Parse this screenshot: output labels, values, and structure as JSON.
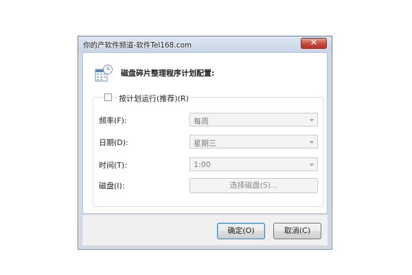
{
  "window": {
    "title": "你的产软件频道-软件Tel168.com",
    "close_symbol": "✕"
  },
  "dialog": {
    "heading": "磁盘碎片整理程序计划配置:",
    "schedule_checkbox": {
      "label": "按计划运行(推荐)(R)",
      "checked": false
    },
    "rows": {
      "frequency": {
        "label": "频率(F):",
        "value": "每周"
      },
      "day": {
        "label": "日期(D):",
        "value": "星期三"
      },
      "time": {
        "label": "时间(T):",
        "value": "1:00"
      },
      "disks": {
        "label": "磁盘(I):",
        "button_label": "选择磁盘(S)..."
      }
    }
  },
  "footer": {
    "ok_label": "确定(O)",
    "cancel_label": "取消(C)"
  },
  "icons": {
    "app": "calendar-clock-icon",
    "close": "close-icon",
    "dropdown": "chevron-down-icon"
  },
  "colors": {
    "default_button_border": "#3c7fb1",
    "close_button": "#c9463a"
  }
}
